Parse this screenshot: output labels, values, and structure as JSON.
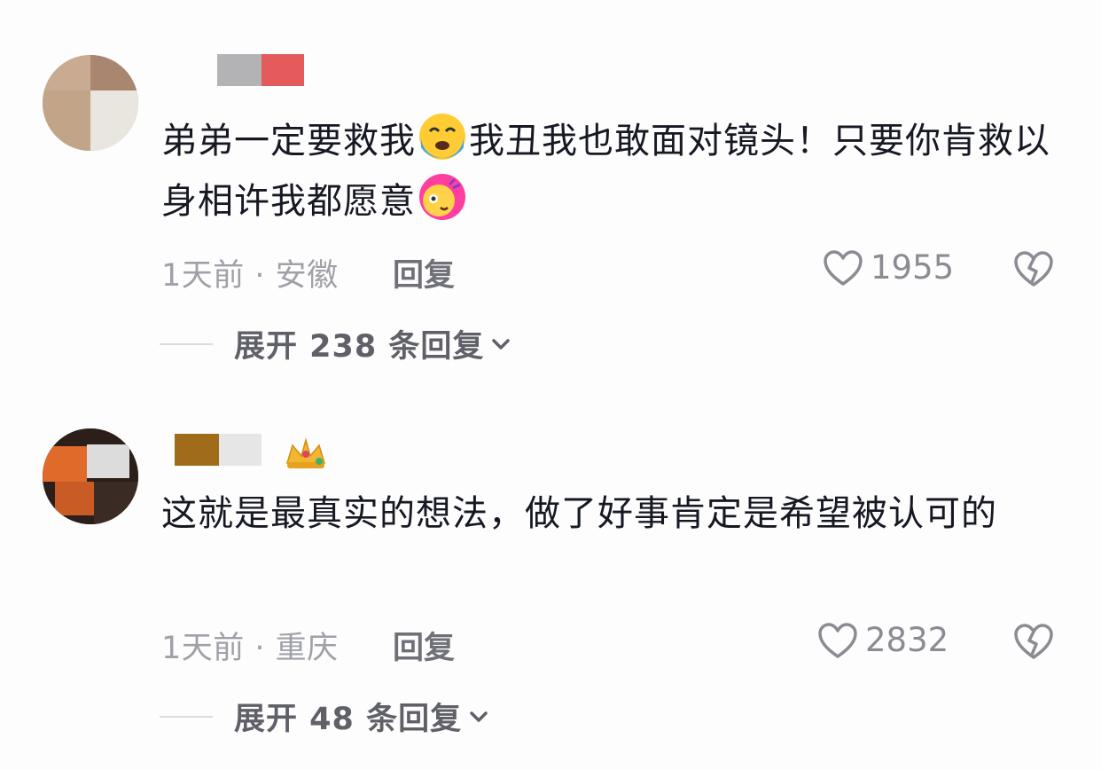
{
  "comments": [
    {
      "text_parts": [
        "弟弟一定要救我",
        "我丑我也敢面对镜头！只要你肯救以身相许我都愿意",
        ""
      ],
      "emojis": [
        "crying-face-emoji",
        "fan-girl-emoji"
      ],
      "time": "1天前",
      "location": "安徽",
      "reply_label": "回复",
      "likes": "1955",
      "expand_label": "展开 238 条回复",
      "name_colors": [
        "#b3b3b6",
        "#e55a5a"
      ]
    },
    {
      "text_parts": [
        "这就是最真实的想法，做了好事肯定是希望被认可的"
      ],
      "emojis": [],
      "has_crown": true,
      "time": "1天前",
      "location": "重庆",
      "reply_label": "回复",
      "likes": "2832",
      "expand_label": "展开 48 条回复",
      "name_colors": [
        "#a06c1a",
        "#e6e6e6"
      ]
    }
  ],
  "separator": " · ",
  "colors": {
    "text": "#161823",
    "meta": "#a0a1a8",
    "reply": "#6f7078",
    "icon": "#8b8c93"
  }
}
